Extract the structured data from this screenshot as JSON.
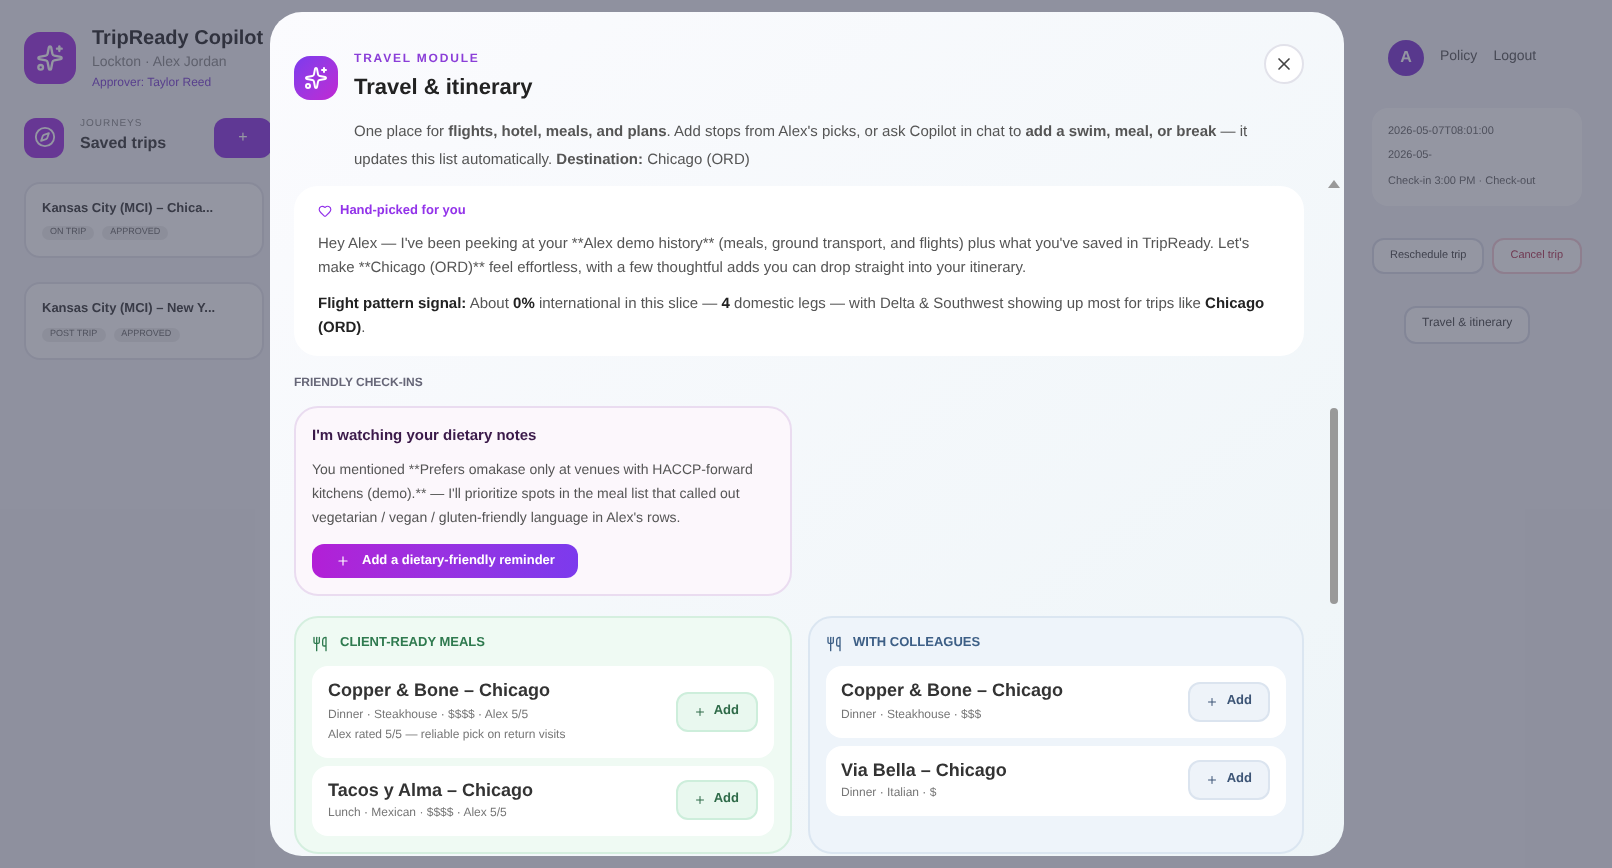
{
  "app": {
    "brand": "TripReady Copilot",
    "subtitle": "Lockton · Alex Jordan",
    "approver": "Approver: Taylor Reed",
    "journeys_eyebrow": "JOURNEYS",
    "journeys_title": "Saved trips",
    "new_button": "+",
    "trips": [
      {
        "title": "Kansas City (MCI) – Chica...",
        "tags": [
          "ON TRIP",
          "APPROVED"
        ]
      },
      {
        "title": "Kansas City (MCI) – New Y...",
        "tags": [
          "POST TRIP",
          "APPROVED"
        ]
      }
    ],
    "avatar": "A",
    "links": [
      "Policy",
      "Logout"
    ],
    "trip_details": [
      "2026-05-07T08:01:00",
      "2026-05-",
      "Check-in 3:00 PM · Check-out"
    ],
    "actions": [
      {
        "label": "Reschedule trip",
        "kind": "neutral"
      },
      {
        "label": "Cancel trip",
        "kind": "danger"
      }
    ],
    "itinerary_button": "Travel & itinerary"
  },
  "modal": {
    "eyebrow": "TRAVEL MODULE",
    "title": "Travel & itinerary",
    "description": "One place for **flights, hotel, meals, and plans**. Add stops from Alex's picks, or ask Copilot in chat to **add a swim, meal, or break** — it updates this list automatically. **Destination:** Chicago (ORD)",
    "intro": {
      "label": "Hand-picked for you",
      "message": "Hey Alex — I've been peeking at your **Alex demo history** (meals, ground transport, and flights) plus what you've saved in TripReady. Let's make **Chicago (ORD)** feel effortless, with a few thoughtful adds you can drop straight into your itinerary.",
      "signal": "**Flight pattern signal:** About **0%** international in this slice — **4** domestic legs — with Delta & Southwest showing up most for trips like **Chicago (ORD)**."
    },
    "checkins_title": "FRIENDLY CHECK-INS",
    "checkins": [
      {
        "title": "I'm watching your dietary notes",
        "body": "You mentioned **Prefers omakase only at venues with HACCP-forward kitchens (demo).** — I'll prioritize spots in the meal list that called out vegetarian / vegan / gluten-friendly language in Alex's rows.",
        "button": "Add a dietary-friendly reminder"
      }
    ],
    "meal_groups": [
      {
        "title": "CLIENT-READY MEALS",
        "kind": "client",
        "meals": [
          {
            "name": "Copper & Bone – Chicago",
            "details": "Dinner · Steakhouse · $$$$ · Alex 5/5",
            "note": "Alex rated 5/5 — reliable pick on return visits",
            "button": "Add"
          },
          {
            "name": "Tacos y Alma – Chicago",
            "details": "Lunch · Mexican · $$$$ · Alex 5/5",
            "button": "Add"
          }
        ]
      },
      {
        "title": "WITH COLLEAGUES",
        "kind": "colleagues",
        "meals": [
          {
            "name": "Copper & Bone – Chicago",
            "details": "Dinner · Steakhouse · $$$",
            "button": "Add"
          },
          {
            "name": "Via Bella – Chicago",
            "details": "Dinner · Italian · $",
            "button": "Add"
          }
        ]
      }
    ]
  }
}
